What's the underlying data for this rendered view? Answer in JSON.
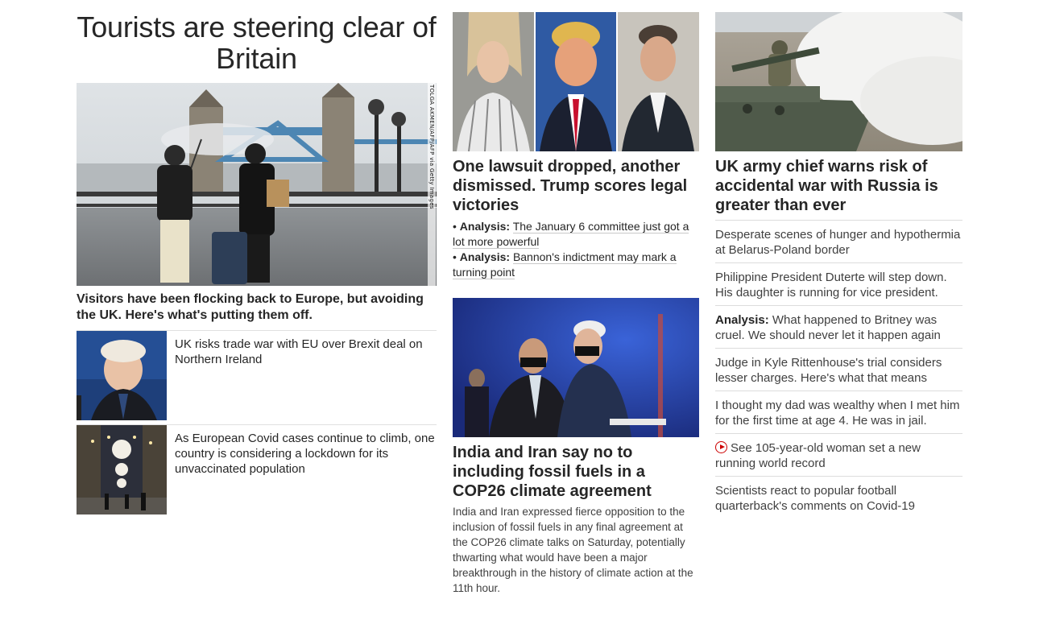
{
  "left": {
    "headline": "Tourists are steering clear of Britain",
    "hero_credit": "TOLGA AKMEN/AFP/AFP via Getty Images",
    "hero_caption": "Visitors have been flocking back to Europe, but avoiding the UK. Here's what's putting them off.",
    "stories": [
      {
        "text": "UK risks trade war with EU over Brexit deal on Northern Ireland"
      },
      {
        "text": "As European Covid cases continue to climb, one country is considering a lockdown for its unvaccinated population"
      }
    ]
  },
  "middle": {
    "headline": "One lawsuit dropped, another dismissed. Trump scores legal victories",
    "analysis": [
      {
        "bullet": "• ",
        "label": "Analysis:",
        "text": "The January 6 committee just got a lot more powerful"
      },
      {
        "bullet": "• ",
        "label": "Analysis:",
        "text": "Bannon's indictment may mark a turning point"
      }
    ],
    "headline2": "India and Iran say no to including fossil fuels in a COP26 climate agreement",
    "description2": "India and Iran expressed fierce opposition to the inclusion of fossil fuels in any final agreement at the COP26 climate talks on Saturday, potentially thwarting what would have been a major breakthrough in the history of climate action at the 11th hour."
  },
  "right": {
    "headline": "UK army chief warns risk of accidental war with Russia is greater than ever",
    "items": [
      {
        "text": "Desperate scenes of hunger and hypothermia at Belarus-Poland border"
      },
      {
        "text": "Philippine President Duterte will step down. His daughter is running for vice president."
      },
      {
        "label": "Analysis:",
        "text": " What happened to Britney was cruel. We should never let it happen again"
      },
      {
        "text": "Judge in Kyle Rittenhouse's trial considers lesser charges. Here's what that means"
      },
      {
        "text": "I thought my dad was wealthy when I met him for the first time at age 4. He was in jail."
      },
      {
        "icon": "play-circle-icon",
        "text": "See 105-year-old woman set a new running world record"
      },
      {
        "text": "Scientists react to popular football quarterback's comments on Covid-19"
      }
    ]
  },
  "colors": {
    "text": "#262626",
    "secondary": "#404040",
    "divider": "#dcdcdc",
    "video_accent": "#cc0000"
  }
}
